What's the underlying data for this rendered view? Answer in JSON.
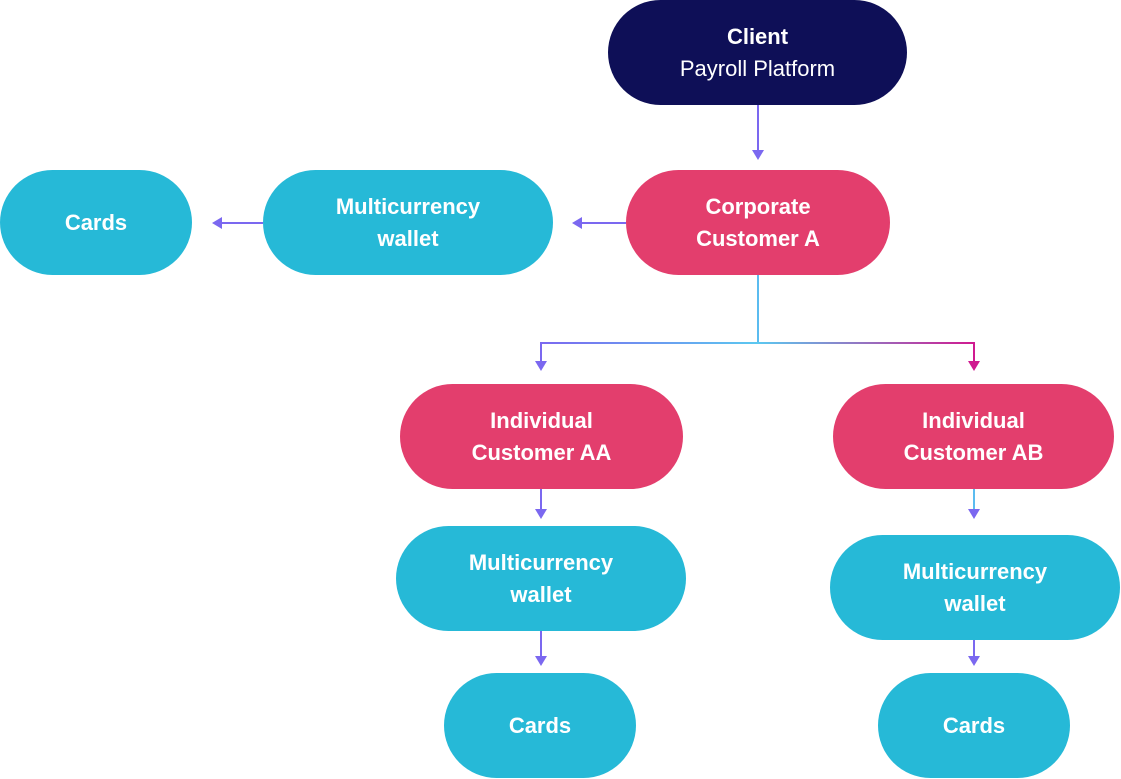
{
  "colors": {
    "client": "#0e0f57",
    "customer": "#e33e6d",
    "product": "#26b9d7",
    "arrow": "#7b68f0",
    "arrow_light": "#5bbcf0",
    "arrow_magenta": "#d01a90",
    "text": "#ffffff"
  },
  "nodes": {
    "client": {
      "title": "Client",
      "subtitle": "Payroll Platform"
    },
    "corporate": {
      "line1": "Corporate",
      "line2": "Customer A"
    },
    "wallet_a": {
      "line1": "Multicurrency",
      "line2": "wallet"
    },
    "cards_a": {
      "label": "Cards"
    },
    "individual_aa": {
      "line1": "Individual",
      "line2": "Customer AA"
    },
    "individual_ab": {
      "line1": "Individual",
      "line2": "Customer AB"
    },
    "wallet_aa": {
      "line1": "Multicurrency",
      "line2": "wallet"
    },
    "wallet_ab": {
      "line1": "Multicurrency",
      "line2": "wallet"
    },
    "cards_aa": {
      "label": "Cards"
    },
    "cards_ab": {
      "label": "Cards"
    }
  },
  "edges": [
    {
      "from": "client",
      "to": "corporate"
    },
    {
      "from": "corporate",
      "to": "wallet_a"
    },
    {
      "from": "wallet_a",
      "to": "cards_a"
    },
    {
      "from": "corporate",
      "to": "individual_aa"
    },
    {
      "from": "corporate",
      "to": "individual_ab"
    },
    {
      "from": "individual_aa",
      "to": "wallet_aa"
    },
    {
      "from": "individual_ab",
      "to": "wallet_ab"
    },
    {
      "from": "wallet_aa",
      "to": "cards_aa"
    },
    {
      "from": "wallet_ab",
      "to": "cards_ab"
    }
  ]
}
